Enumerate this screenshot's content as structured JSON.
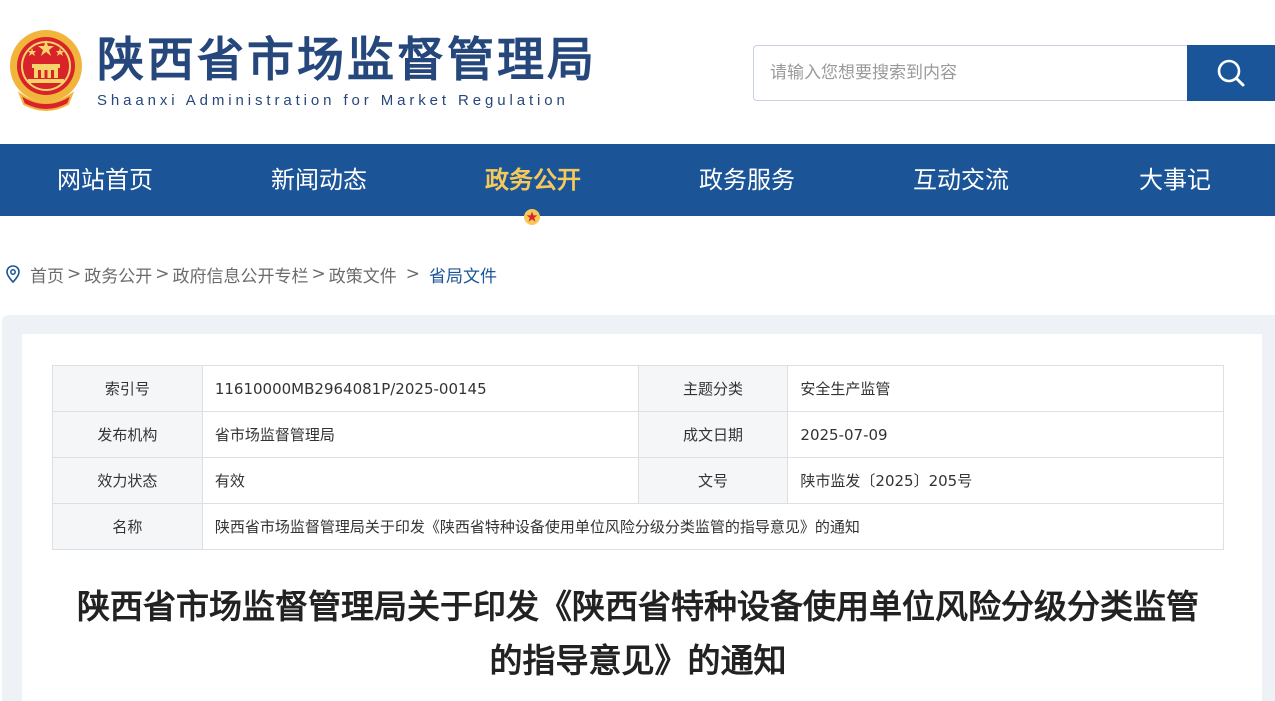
{
  "header": {
    "title": "陕西省市场监督管理局",
    "subtitle": "Shaanxi Administration for Market Regulation",
    "emblem_icon": "national-emblem-icon"
  },
  "search": {
    "placeholder": "请输入您想要搜索到内容",
    "icon": "search-icon"
  },
  "nav": {
    "items": [
      {
        "label": "网站首页",
        "active": false
      },
      {
        "label": "新闻动态",
        "active": false
      },
      {
        "label": "政务公开",
        "active": true
      },
      {
        "label": "政务服务",
        "active": false
      },
      {
        "label": "互动交流",
        "active": false
      },
      {
        "label": "大事记",
        "active": false
      }
    ],
    "active_color": "#f6c95a",
    "bg_color": "#1b5597"
  },
  "breadcrumb": {
    "icon": "location-pin-icon",
    "items": [
      "首页",
      "政务公开",
      "政府信息公开专栏",
      "政策文件",
      "省局文件"
    ]
  },
  "meta": {
    "index_label": "索引号",
    "index_value": "11610000MB2964081P/2025-00145",
    "topic_label": "主题分类",
    "topic_value": "安全生产监管",
    "publisher_label": "发布机构",
    "publisher_value": "省市场监督管理局",
    "date_label": "成文日期",
    "date_value": "2025-07-09",
    "status_label": "效力状态",
    "status_value": "有效",
    "docno_label": "文号",
    "docno_value": "陕市监发〔2025〕205号",
    "name_label": "名称",
    "name_value": "陕西省市场监督管理局关于印发《陕西省特种设备使用单位风险分级分类监管的指导意见》的通知"
  },
  "article": {
    "title_line1": "陕西省市场监督管理局关于印发《陕西省特种设备使用单位风险分级分类监管",
    "title_line2": "的指导意见》的通知"
  }
}
